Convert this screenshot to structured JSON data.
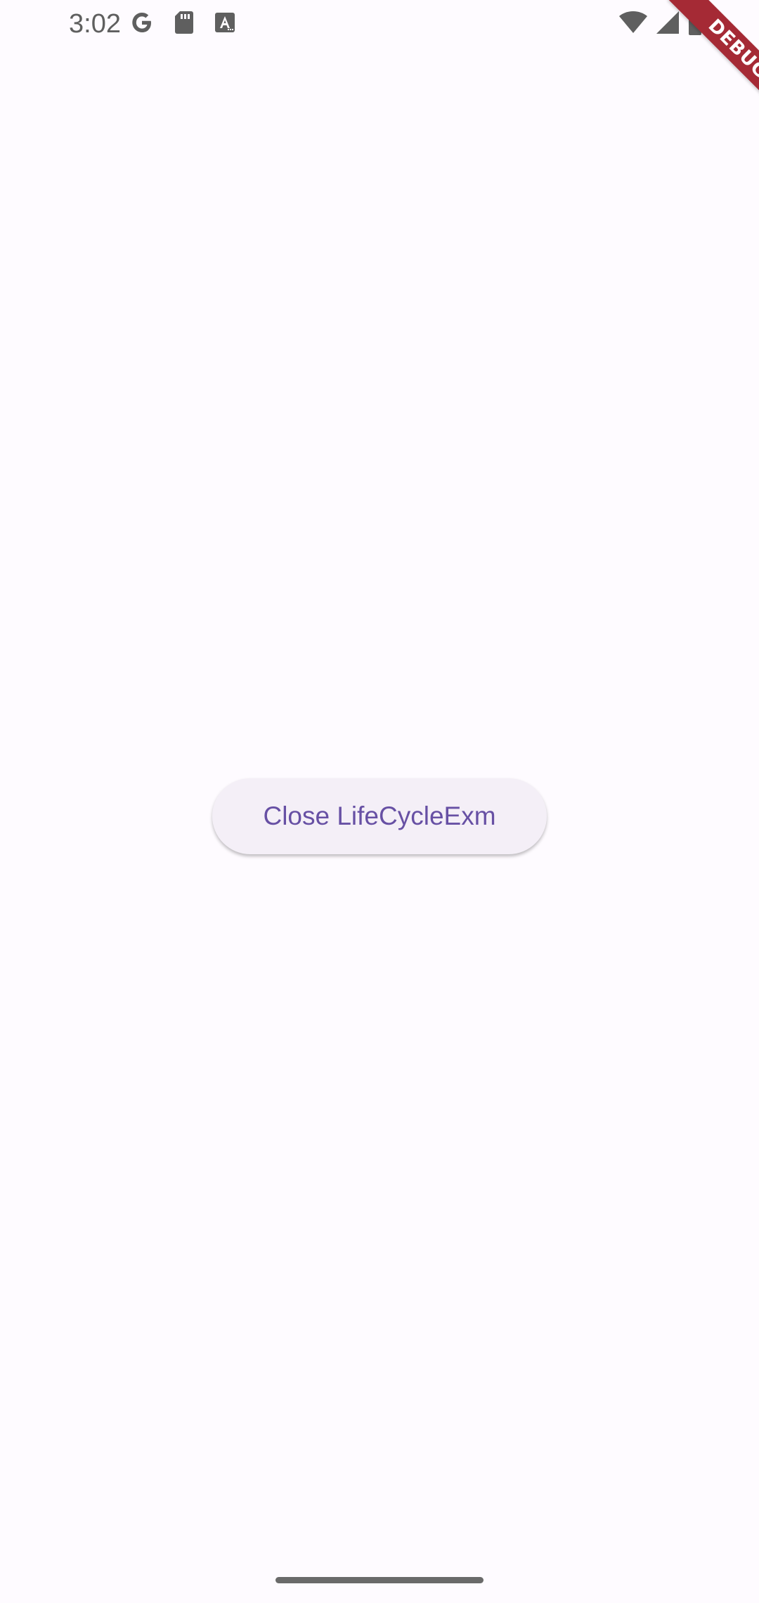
{
  "status_bar": {
    "time": "3:02",
    "left_icons": [
      "google-icon",
      "sd-card-icon",
      "font-a-icon"
    ],
    "right_icons": [
      "wifi-icon",
      "cell-signal-icon",
      "battery-icon"
    ]
  },
  "debug_banner": {
    "label": "DEBUG",
    "color": "#a52a35"
  },
  "main": {
    "button_label": "Close LifeCycleExm",
    "button_bg": "#f4eff7",
    "button_text_color": "#6750a4"
  },
  "background": "#fefbff"
}
